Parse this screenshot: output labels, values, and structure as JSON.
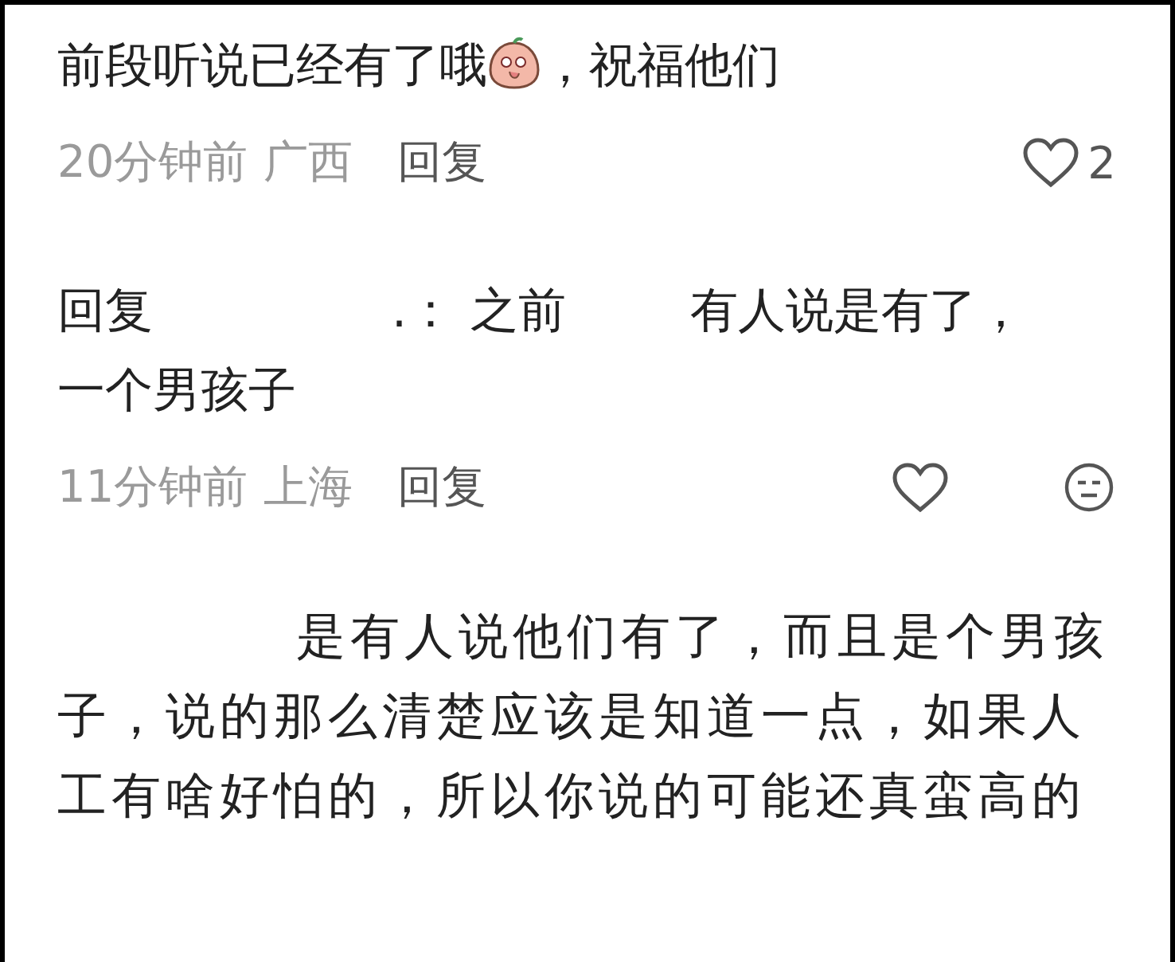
{
  "comments": [
    {
      "kind": "plain",
      "text_before": "前段听说已经有了哦",
      "has_emoji": true,
      "text_after": "，祝福他们",
      "time": "20分钟前",
      "location": "广西",
      "reply_label": "回复",
      "like_count": "2",
      "show_face": false
    },
    {
      "kind": "reply",
      "parts": [
        "回复",
        ".：",
        "之前",
        "有人说是有了，",
        "一个男孩子"
      ],
      "time": "11分钟前",
      "location": "上海",
      "reply_label": "回复",
      "show_face": true
    },
    {
      "kind": "indented",
      "text": "是有人说他们有了，而且是个男孩子，说的那么清楚应该是知道一点，如果人工有啥好怕的，所以你说的可能还真蛮高的"
    }
  ]
}
